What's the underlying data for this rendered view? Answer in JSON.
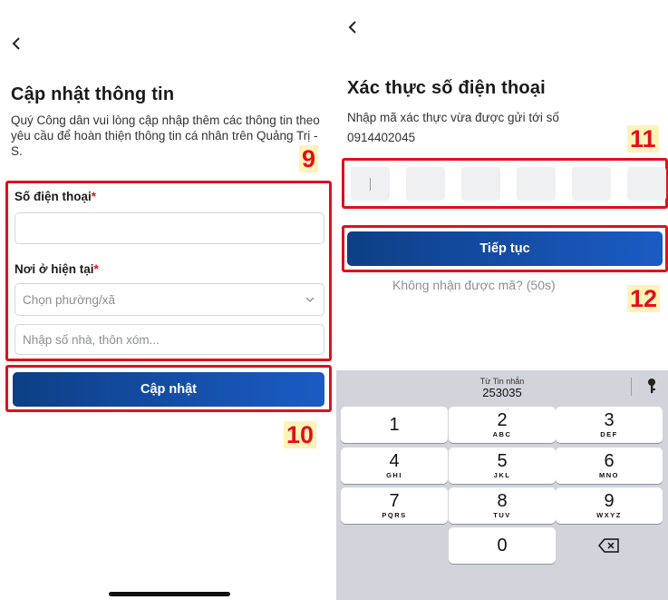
{
  "left": {
    "title": "Cập nhật thông tin",
    "description": "Quý Công dân vui lòng cập nhập thêm các thông tin theo yêu cầu để hoàn thiện thông tin cá nhân trên Quảng Trị - S.",
    "phone_label": "Số điện thoại",
    "phone_value": "",
    "address_label": "Nơi ở hiện tại",
    "ward_placeholder": "Chọn phường/xã",
    "detail_placeholder": "Nhập số nhà, thôn xóm...",
    "submit_label": "Cập nhật",
    "step_form": "9",
    "step_submit": "10",
    "required_mark": "*"
  },
  "right": {
    "title": "Xác thực số điện thoại",
    "description": "Nhập mã xác thực vừa được gửi tới số",
    "phone_number": "0914402045",
    "continue_label": "Tiếp tục",
    "resend_text": "Không nhận được mã? (50s)",
    "step_otp": "11",
    "step_continue": "12",
    "otp_count": 6
  },
  "keyboard": {
    "suggestion_source": "Từ Tin nhắn",
    "suggestion_code": "253035",
    "keys": [
      {
        "digit": "1",
        "letters": ""
      },
      {
        "digit": "2",
        "letters": "ABC"
      },
      {
        "digit": "3",
        "letters": "DEF"
      },
      {
        "digit": "4",
        "letters": "GHI"
      },
      {
        "digit": "5",
        "letters": "JKL"
      },
      {
        "digit": "6",
        "letters": "MNO"
      },
      {
        "digit": "7",
        "letters": "PQRS"
      },
      {
        "digit": "8",
        "letters": "TUV"
      },
      {
        "digit": "9",
        "letters": "WXYZ"
      },
      {
        "digit": "0",
        "letters": ""
      }
    ],
    "icons": [
      "key-icon",
      "backspace-icon"
    ]
  },
  "colors": {
    "accent_start": "#0e3f86",
    "accent_end": "#1a5bc4",
    "highlight": "#e0101a",
    "step_bg": "#fff3b8"
  }
}
